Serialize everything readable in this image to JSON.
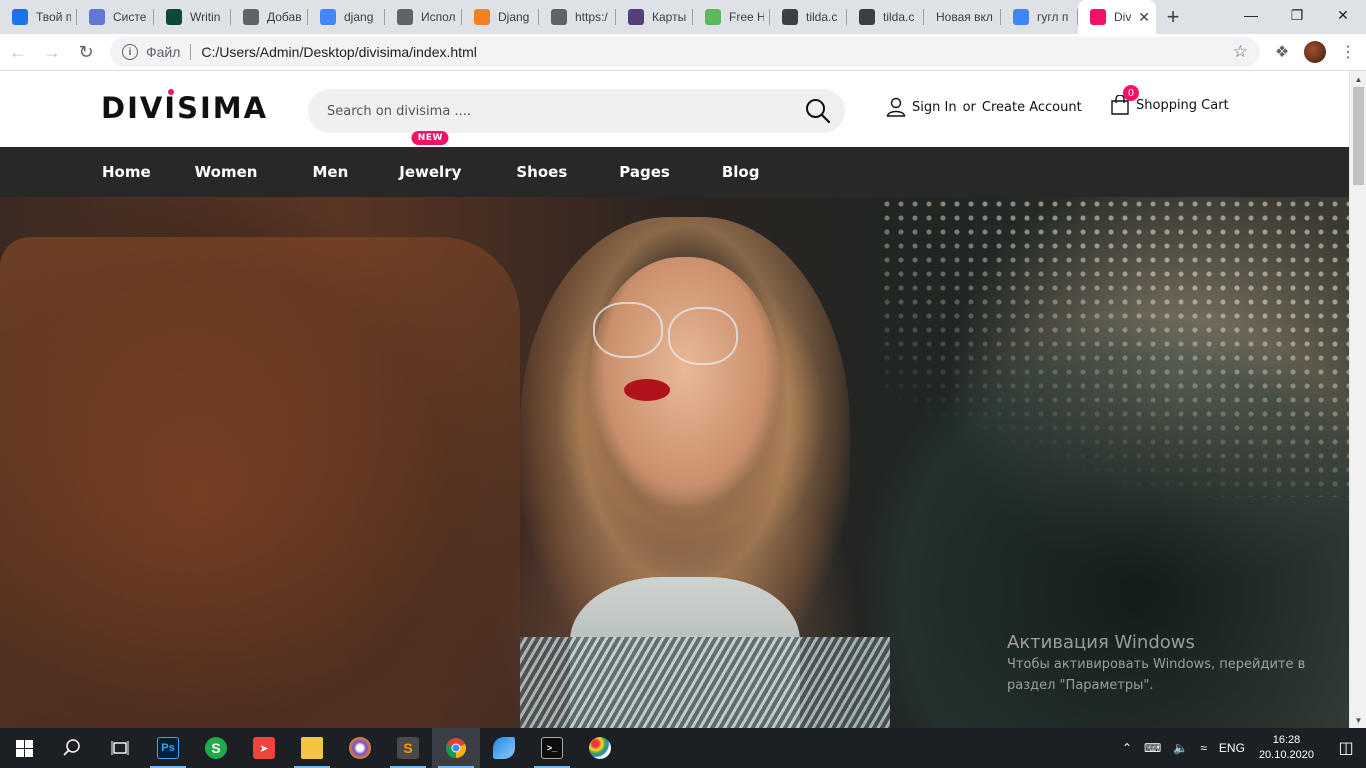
{
  "browser": {
    "tabs": [
      {
        "title": "Твой п",
        "favicon": "book-icon",
        "color": "#1a73e8"
      },
      {
        "title": "Систе",
        "favicon": "u-icon",
        "color": "#5b7bd5"
      },
      {
        "title": "Writin",
        "favicon": "dj-icon",
        "color": "#0c4b33"
      },
      {
        "title": "Добав",
        "favicon": "globe-icon",
        "color": "#5f6368"
      },
      {
        "title": "djang",
        "favicon": "google-icon",
        "color": "#4285f4"
      },
      {
        "title": "Испол",
        "favicon": "globe-icon",
        "color": "#5f6368"
      },
      {
        "title": "Djang",
        "favicon": "stackoverflow-icon",
        "color": "#f48024"
      },
      {
        "title": "https:/",
        "favicon": "globe-icon",
        "color": "#5f6368"
      },
      {
        "title": "Карты",
        "favicon": "bootstrap-icon",
        "color": "#563d7c"
      },
      {
        "title": "Free H",
        "favicon": "leaf-icon",
        "color": "#5cb85c"
      },
      {
        "title": "tilda.c",
        "favicon": "tilda-icon",
        "color": "#3c4043"
      },
      {
        "title": "tilda.c",
        "favicon": "tilda-icon",
        "color": "#3c4043"
      },
      {
        "title": "Новая вкл",
        "favicon": "",
        "color": ""
      },
      {
        "title": "гугл п",
        "favicon": "google-icon",
        "color": "#4285f4"
      },
      {
        "title": "Div",
        "favicon": "flag-icon",
        "color": "#f51167",
        "active": true
      }
    ],
    "address": {
      "protocol_label": "Файл",
      "url": "C:/Users/Admin/Desktop/divisima/index.html"
    }
  },
  "site": {
    "logo": "DIVISIMA",
    "search_placeholder": "Search on divisima ....",
    "signin": "Sign In",
    "or": "or",
    "create_account": "Create Account",
    "cart_label": "Shopping Cart",
    "cart_count": "0",
    "accent": "#f51167",
    "nav": [
      {
        "label": "Home"
      },
      {
        "label": "Women"
      },
      {
        "label": "Men"
      },
      {
        "label": "Jewelry",
        "badge": "NEW"
      },
      {
        "label": "Shoes"
      },
      {
        "label": "Pages"
      },
      {
        "label": "Blog"
      }
    ]
  },
  "watermark": {
    "title": "Активация Windows",
    "line": "Чтобы активировать Windows, перейдите в раздел \"Параметры\"."
  },
  "taskbar": {
    "lang": "ENG",
    "time": "16:28",
    "date": "20.10.2020"
  }
}
